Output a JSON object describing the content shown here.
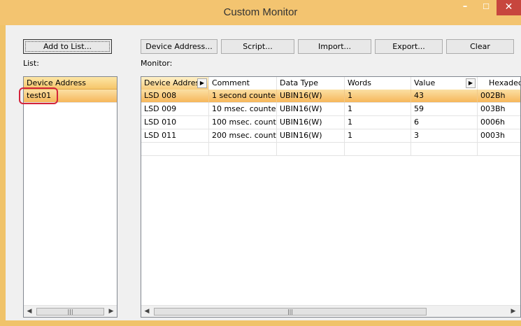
{
  "window": {
    "title": "Custom Monitor",
    "min_glyph": "–",
    "max_glyph": "☐",
    "close_glyph": "✕"
  },
  "toolbar": {
    "add_to_list": "Add to List...",
    "device_address": "Device Address...",
    "script": "Script...",
    "import": "Import...",
    "export": "Export...",
    "clear": "Clear"
  },
  "list_label": "List:",
  "monitor_label": "Monitor:",
  "list": {
    "header": "Device Address",
    "items": [
      "test01"
    ]
  },
  "monitor": {
    "columns": [
      "Device Address",
      "Comment",
      "Data Type",
      "Words",
      "Value",
      "Hexadecin"
    ],
    "rows": [
      [
        "LSD 008",
        "1 second counte...",
        "UBIN16(W)",
        "1",
        "43",
        "002Bh"
      ],
      [
        "LSD 009",
        "10 msec. counte...",
        "UBIN16(W)",
        "1",
        "59",
        "003Bh"
      ],
      [
        "LSD 010",
        "100 msec. count...",
        "UBIN16(W)",
        "1",
        "6",
        "0006h"
      ],
      [
        "LSD 011",
        "200 msec. count...",
        "UBIN16(W)",
        "1",
        "3",
        "0003h"
      ]
    ],
    "selected_row": 0
  },
  "scroll": {
    "thumb_glyph": "|||",
    "left_arrow": "◀",
    "right_arrow": "▶"
  },
  "colors": {
    "accent": "#f6b75b",
    "title_bar": "#f3c470",
    "close": "#c7463e",
    "highlight_ring": "#d4233b"
  }
}
